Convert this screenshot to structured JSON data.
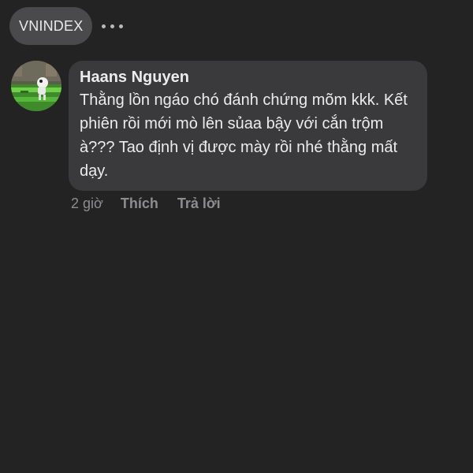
{
  "header": {
    "tag_label": "VNINDEX",
    "more_icon": "more-horizontal-icon"
  },
  "comment": {
    "author": "Haans Nguyen",
    "text": "Thằng lồn ngáo chó đánh chứng mõm kkk. Kết phiên rồi mới mò lên sủaa bậy với cắn trộm à??? Tao định vị được mày rồi nhé thằng mất dạy.",
    "time": "2 giờ",
    "like_label": "Thích",
    "reply_label": "Trả lời"
  },
  "colors": {
    "background": "#232323",
    "bubble": "#3a3a3c",
    "chip": "#4a4a4c",
    "muted": "#8d8d90"
  }
}
